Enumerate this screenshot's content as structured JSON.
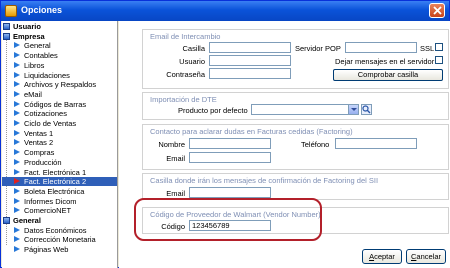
{
  "window": {
    "title": "Opciones"
  },
  "tree": {
    "items": [
      {
        "label": "Usuario",
        "level": 0,
        "selected": false
      },
      {
        "label": "Empresa",
        "level": 0,
        "selected": false
      },
      {
        "label": "General",
        "level": 1,
        "selected": false
      },
      {
        "label": "Contables",
        "level": 1,
        "selected": false
      },
      {
        "label": "Libros",
        "level": 1,
        "selected": false
      },
      {
        "label": "Liquidaciones",
        "level": 1,
        "selected": false
      },
      {
        "label": "Archivos y Respaldos",
        "level": 1,
        "selected": false
      },
      {
        "label": "eMail",
        "level": 1,
        "selected": false
      },
      {
        "label": "Códigos de Barras",
        "level": 1,
        "selected": false
      },
      {
        "label": "Cotizaciones",
        "level": 1,
        "selected": false
      },
      {
        "label": "Ciclo de Ventas",
        "level": 1,
        "selected": false
      },
      {
        "label": "Ventas 1",
        "level": 1,
        "selected": false
      },
      {
        "label": "Ventas 2",
        "level": 1,
        "selected": false
      },
      {
        "label": "Compras",
        "level": 1,
        "selected": false
      },
      {
        "label": "Producción",
        "level": 1,
        "selected": false
      },
      {
        "label": "Fact. Electrónica 1",
        "level": 1,
        "selected": false
      },
      {
        "label": "Fact. Electrónica 2",
        "level": 1,
        "selected": true
      },
      {
        "label": "Boleta Electrónica",
        "level": 1,
        "selected": false
      },
      {
        "label": "Informes Dicom",
        "level": 1,
        "selected": false
      },
      {
        "label": "ComercioNET",
        "level": 1,
        "selected": false
      },
      {
        "label": "General",
        "level": 0,
        "selected": false
      },
      {
        "label": "Datos Económicos",
        "level": 1,
        "selected": false
      },
      {
        "label": "Corrección Monetaria",
        "level": 1,
        "selected": false
      },
      {
        "label": "Páginas Web",
        "level": 1,
        "selected": false
      }
    ]
  },
  "email": {
    "title": "Email de Intercambio",
    "casilla_label": "Casilla",
    "casilla_value": "",
    "usuario_label": "Usuario",
    "usuario_value": "",
    "contrasena_label": "Contraseña",
    "contrasena_value": "",
    "servidor_label": "Servidor POP",
    "servidor_value": "",
    "ssl_label": "SSL",
    "dejar_label": "Dejar mensajes en el servidor",
    "comprobar_label": "Comprobar casilla"
  },
  "dte": {
    "title": "Importación de DTE",
    "producto_label": "Producto por defecto",
    "producto_value": ""
  },
  "contacto": {
    "title": "Contacto para aclarar dudas en Facturas cedidas (Factoring)",
    "nombre_label": "Nombre",
    "nombre_value": "",
    "telefono_label": "Teléfono",
    "telefono_value": "",
    "email_label": "Email",
    "email_value": ""
  },
  "casilla_sii": {
    "title": "Casilla donde irán los mensajes de confirmación de Factoring del SII",
    "email_label": "Email",
    "email_value": ""
  },
  "walmart": {
    "title": "Código de Proveedor de Walmart (Vendor Number)",
    "codigo_label": "Código",
    "codigo_value": "123456789"
  },
  "footer": {
    "aceptar_label": "Aceptar",
    "cancelar_label": "Cancelar"
  },
  "colors": {
    "title_bar": "#0a53d9",
    "selection": "#2f5fb8",
    "highlight": "#b3202a",
    "section_title": "#7f8fb4"
  }
}
